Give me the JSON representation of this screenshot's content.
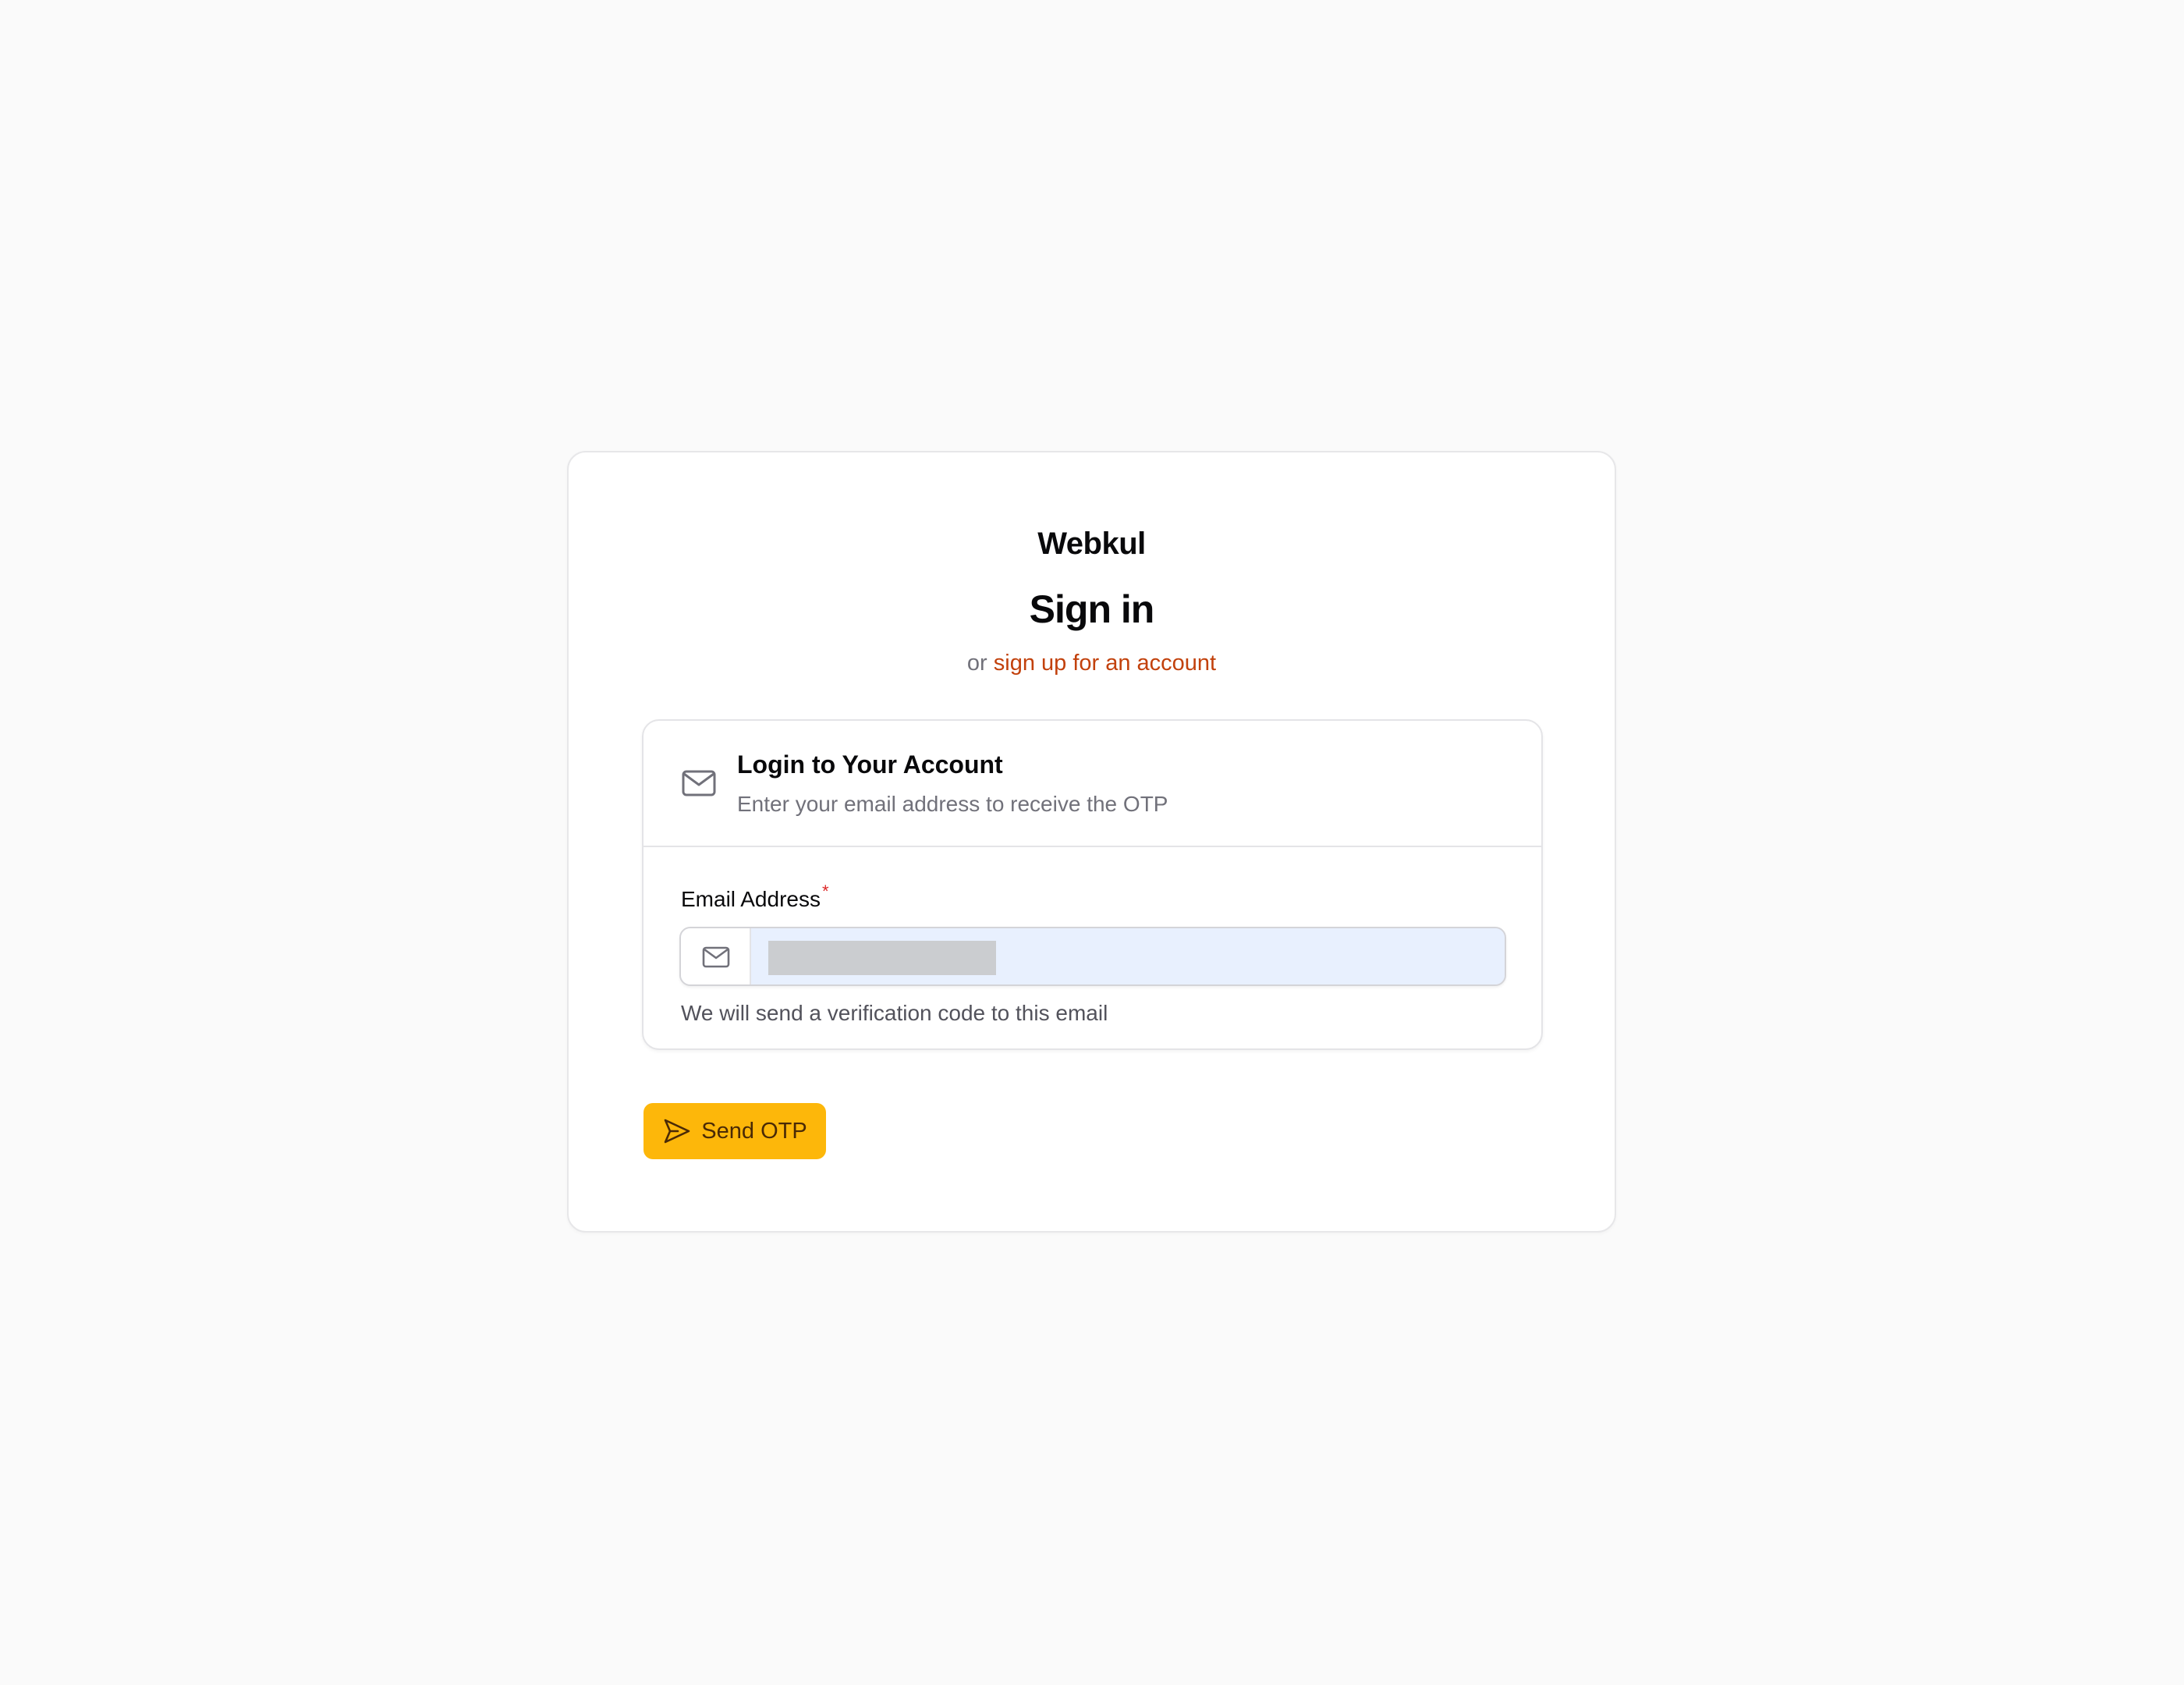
{
  "brand": "Webkul",
  "page_title": "Sign in",
  "subline": {
    "prefix": "or",
    "link_label": "sign up for an account"
  },
  "login_panel": {
    "icon": "mail-icon",
    "title": "Login to Your Account",
    "description": "Enter your email address to receive the OTP",
    "email_field": {
      "label": "Email Address",
      "required_mark": "*",
      "icon": "mail-icon",
      "value": "",
      "value_redacted": true,
      "helper_text": "We will send a verification code to this email"
    }
  },
  "send_button": {
    "icon": "send-icon",
    "label": "Send OTP"
  },
  "colors": {
    "page_background": "#fafafa",
    "link": "#c2410c",
    "button_background": "#fdb70a",
    "button_text": "#4a2a06",
    "required_mark": "#dc2626",
    "autofill_background": "#e8f0fe"
  }
}
